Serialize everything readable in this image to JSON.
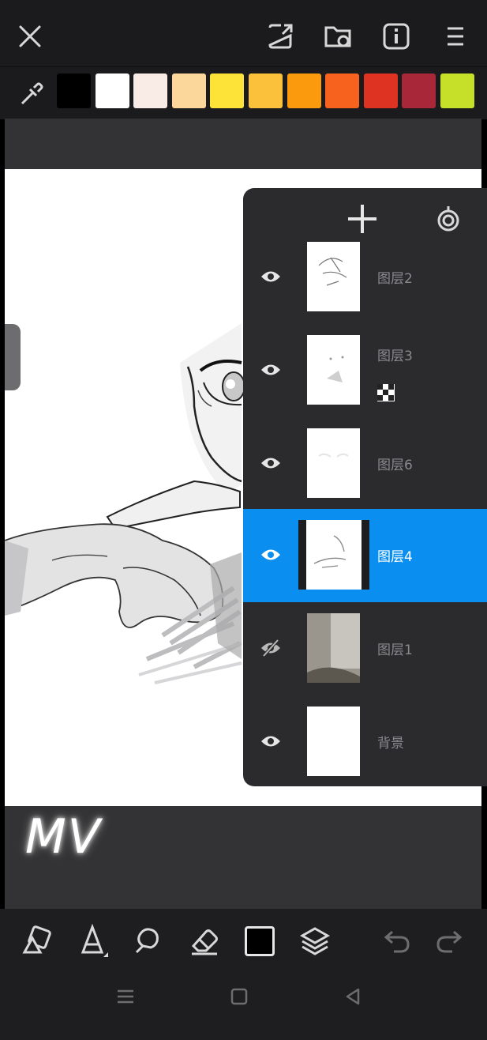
{
  "toolbar": {
    "icons": [
      "close-icon",
      "export-icon",
      "gallery-icon",
      "info-icon",
      "menu-icon"
    ]
  },
  "palette": {
    "colors": [
      "#000000",
      "#ffffff",
      "#f9ebe6",
      "#fcd79c",
      "#fde338",
      "#fcc13b",
      "#fb9a0c",
      "#f8621f",
      "#de3323",
      "#a8283a",
      "#c6e02a"
    ]
  },
  "watermark": "MV",
  "layers_panel": {
    "add_icon": "plus-icon",
    "more_icon": "layer-options-icon",
    "layers": [
      {
        "name": "图层2",
        "visible": true,
        "selected": false
      },
      {
        "name": "图层3",
        "visible": true,
        "selected": false,
        "alpha_lock": true
      },
      {
        "name": "图层6",
        "visible": true,
        "selected": false
      },
      {
        "name": "图层4",
        "visible": true,
        "selected": true
      },
      {
        "name": "图层1",
        "visible": false,
        "selected": false
      },
      {
        "name": "背景",
        "visible": true,
        "selected": false
      }
    ]
  },
  "bottom_toolbar": {
    "icons": [
      "shape-tool-icon",
      "pen-tool-icon",
      "smudge-tool-icon",
      "eraser-icon",
      "current-color-swatch",
      "layers-icon",
      "undo-icon",
      "redo-icon"
    ],
    "current_color": "#000000"
  },
  "navbar": {
    "icons": [
      "nav-menu-icon",
      "nav-home-icon",
      "nav-back-icon"
    ]
  }
}
